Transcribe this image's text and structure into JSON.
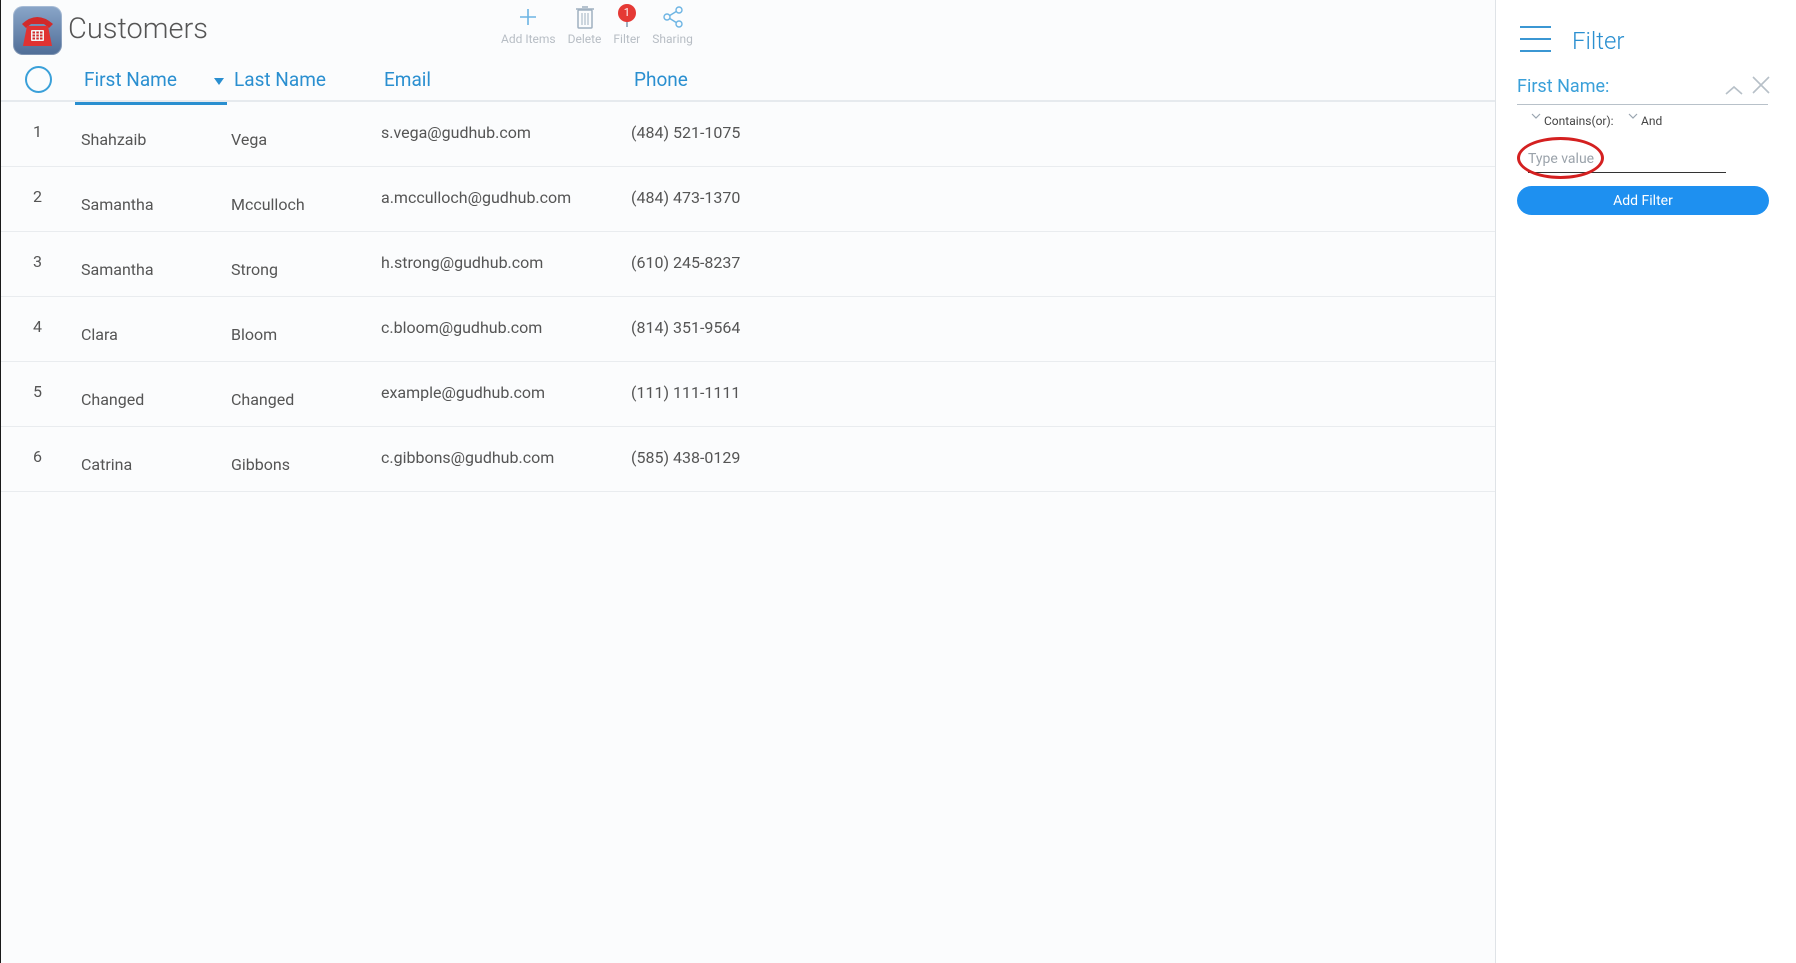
{
  "header": {
    "title": "Customers",
    "toolbar": {
      "add_items": "Add Items",
      "delete": "Delete",
      "filter": "Filter",
      "filter_badge": "1",
      "sharing": "Sharing"
    }
  },
  "table": {
    "columns": [
      "First Name",
      "Last Name",
      "Email",
      "Phone"
    ],
    "rows": [
      {
        "num": "1",
        "first": "Shahzaib",
        "last": "Vega",
        "email": "s.vega@gudhub.com",
        "phone": "(484) 521-1075"
      },
      {
        "num": "2",
        "first": "Samantha",
        "last": "Mcculloch",
        "email": "a.mcculloch@gudhub.com",
        "phone": "(484) 473-1370"
      },
      {
        "num": "3",
        "first": "Samantha",
        "last": "Strong",
        "email": "h.strong@gudhub.com",
        "phone": "(610) 245-8237"
      },
      {
        "num": "4",
        "first": "Clara",
        "last": "Bloom",
        "email": "c.bloom@gudhub.com",
        "phone": "(814) 351-9564"
      },
      {
        "num": "5",
        "first": "Changed",
        "last": "Changed",
        "email": "example@gudhub.com",
        "phone": "(111) 111-1111"
      },
      {
        "num": "6",
        "first": "Catrina",
        "last": "Gibbons",
        "email": "c.gibbons@gudhub.com",
        "phone": "(585) 438-0129"
      }
    ]
  },
  "filter_panel": {
    "title": "Filter",
    "field_label": "First Name:",
    "operator": "Contains(or):",
    "logic": "And",
    "value": "",
    "placeholder": "Type value",
    "add_button": "Add Filter"
  },
  "colors": {
    "accent": "#2a8fd0",
    "button": "#1e90f0",
    "badge": "#e53935",
    "highlight": "#d42020"
  }
}
